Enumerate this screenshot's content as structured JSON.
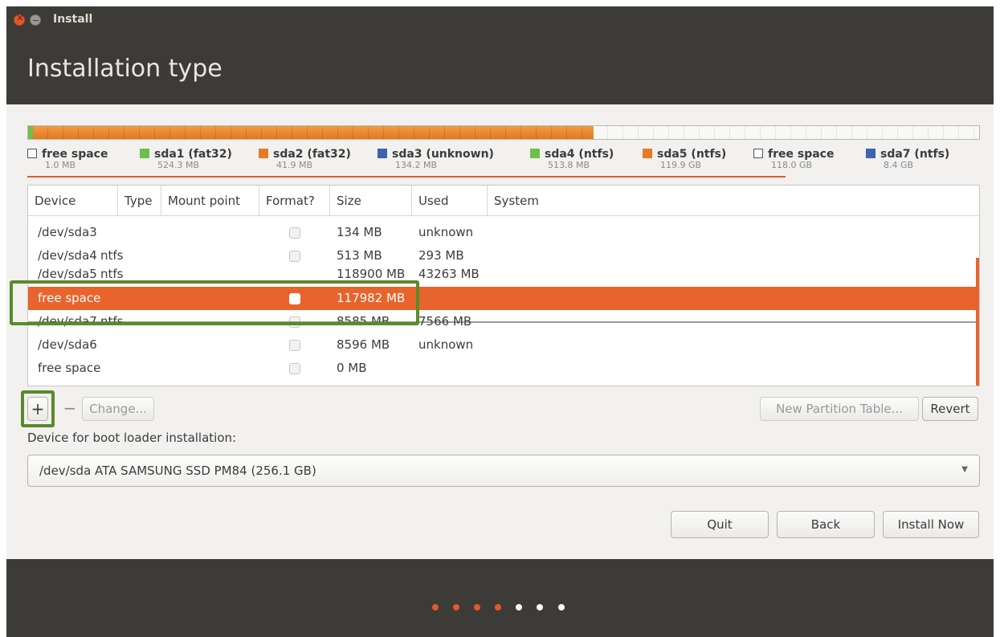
{
  "window": {
    "title": "Install"
  },
  "page": {
    "title": "Installation type"
  },
  "partition_bar": {
    "accent": "#e87a22"
  },
  "legend": [
    {
      "name": "free space",
      "size": "1.0 MB",
      "color": "empty"
    },
    {
      "name": "sda1 (fat32)",
      "size": "524.3 MB",
      "color": "green"
    },
    {
      "name": "sda2 (fat32)",
      "size": "41.9 MB",
      "color": "orange"
    },
    {
      "name": "sda3 (unknown)",
      "size": "134.2 MB",
      "color": "blue"
    },
    {
      "name": "sda4 (ntfs)",
      "size": "513.8 MB",
      "color": "green"
    },
    {
      "name": "sda5 (ntfs)",
      "size": "119.9 GB",
      "color": "orange"
    },
    {
      "name": "free space",
      "size": "118.0 GB",
      "color": "empty"
    },
    {
      "name": "sda7 (ntfs)",
      "size": "8.4 GB",
      "color": "blue"
    }
  ],
  "table": {
    "headers": [
      "Device",
      "Type",
      "Mount point",
      "Format?",
      "Size",
      "Used",
      "System"
    ],
    "rows": [
      {
        "device": "/dev/sda3",
        "type": "",
        "mount": "",
        "size": "134 MB",
        "used": "unknown",
        "selected": false
      },
      {
        "device": "/dev/sda4",
        "type": "ntfs",
        "mount": "",
        "size": "513 MB",
        "used": "293 MB",
        "selected": false
      },
      {
        "device": "/dev/sda5",
        "type": "ntfs",
        "mount": "",
        "size": "118900 MB",
        "used": "43263 MB",
        "selected": false
      },
      {
        "device": "free space",
        "type": "",
        "mount": "",
        "size": "117982 MB",
        "used": "",
        "selected": true
      },
      {
        "device": "/dev/sda7",
        "type": "ntfs",
        "mount": "",
        "size": "8585 MB",
        "used": "7566 MB",
        "selected": false
      },
      {
        "device": "/dev/sda6",
        "type": "",
        "mount": "",
        "size": "8596 MB",
        "used": "unknown",
        "selected": false
      },
      {
        "device": "free space",
        "type": "",
        "mount": "",
        "size": "0 MB",
        "used": "",
        "selected": false
      }
    ]
  },
  "actions": {
    "add": "+",
    "remove": "−",
    "change": "Change...",
    "new_table": "New Partition Table...",
    "revert": "Revert"
  },
  "boot": {
    "label": "Device for boot loader installation:",
    "value": "/dev/sda   ATA SAMSUNG SSD PM84 (256.1 GB)"
  },
  "nav": {
    "quit": "Quit",
    "back": "Back",
    "install": "Install Now"
  },
  "progress": {
    "current_step": 4,
    "total_steps": 7
  }
}
